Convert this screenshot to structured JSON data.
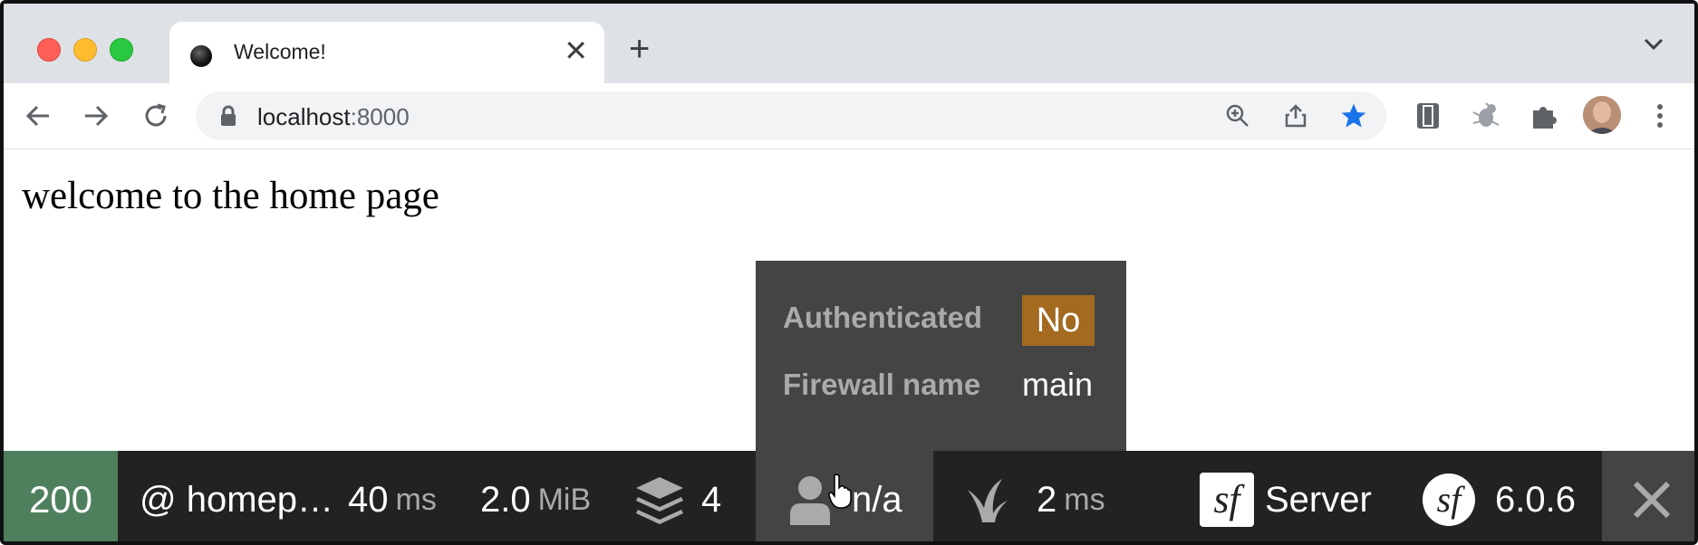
{
  "tab": {
    "title": "Welcome!"
  },
  "toolbar": {
    "url_host": "localhost",
    "url_port": ":8000"
  },
  "page": {
    "text": "welcome to the home page"
  },
  "popup": {
    "authenticated_label": "Authenticated",
    "authenticated_value": "No",
    "firewall_label": "Firewall name",
    "firewall_value": "main"
  },
  "debug_bar": {
    "status_code": "200",
    "route": "@ homep…",
    "time_value": "40",
    "time_unit": "ms",
    "memory_value": "2.0",
    "memory_unit": "MiB",
    "layers_count": "4",
    "user": "n/a",
    "twig_value": "2",
    "twig_unit": "ms",
    "server_label": "Server",
    "version": "6.0.6"
  },
  "colors": {
    "status_ok": "#4f805d",
    "badge_no": "#a46a1f",
    "star": "#1a73e8"
  }
}
